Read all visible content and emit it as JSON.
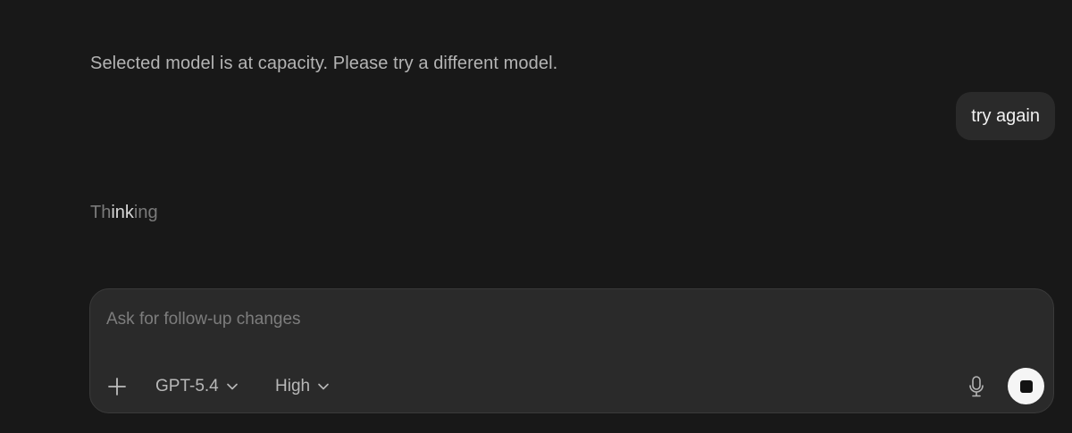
{
  "conversation": {
    "system_message": "Selected model is at capacity. Please try a different model.",
    "user_message": "try again",
    "thinking": {
      "part1": "Th",
      "part2": "ink",
      "part3": "ing"
    }
  },
  "composer": {
    "placeholder": "Ask for follow-up changes",
    "value": "",
    "add_icon": "plus-icon",
    "model": {
      "label": "GPT-5.4",
      "icon": "chevron-down-icon"
    },
    "effort": {
      "label": "High",
      "icon": "chevron-down-icon"
    },
    "mic_icon": "microphone-icon",
    "stop_icon": "stop-icon"
  },
  "colors": {
    "background": "#181818",
    "composer_background": "#2a2a2a",
    "bubble_background": "#2a2a2a",
    "stop_button": "#f5f5f5"
  }
}
